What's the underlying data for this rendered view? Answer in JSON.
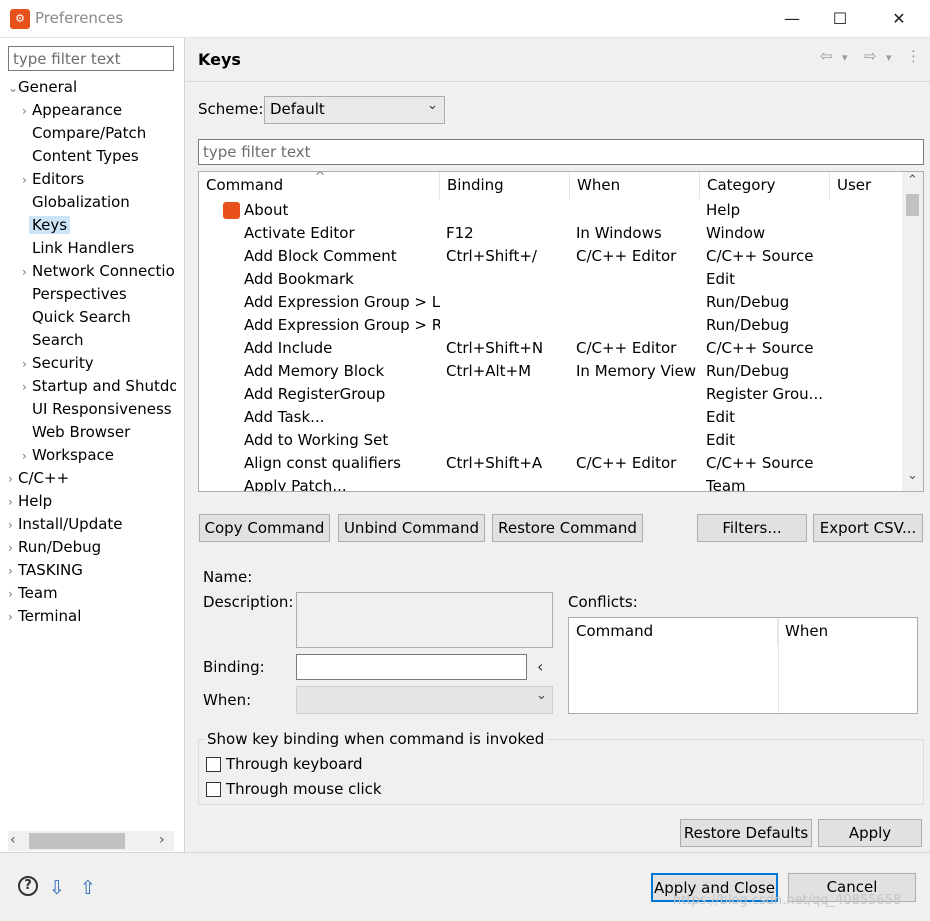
{
  "window": {
    "title": "Preferences",
    "minimize_glyph": "—",
    "maximize_glyph": "☐",
    "close_glyph": "✕",
    "icon": "eclipse-app-icon"
  },
  "left": {
    "filter_placeholder": "type filter text",
    "tree": [
      {
        "label": "General",
        "level": 0,
        "arrow": "⌄"
      },
      {
        "label": "Appearance",
        "level": 1,
        "arrow": "›"
      },
      {
        "label": "Compare/Patch",
        "level": 1,
        "arrow": ""
      },
      {
        "label": "Content Types",
        "level": 1,
        "arrow": ""
      },
      {
        "label": "Editors",
        "level": 1,
        "arrow": "›"
      },
      {
        "label": "Globalization",
        "level": 1,
        "arrow": ""
      },
      {
        "label": "Keys",
        "level": 1,
        "arrow": "",
        "selected": true
      },
      {
        "label": "Link Handlers",
        "level": 1,
        "arrow": ""
      },
      {
        "label": "Network Connectio",
        "level": 1,
        "arrow": "›"
      },
      {
        "label": "Perspectives",
        "level": 1,
        "arrow": ""
      },
      {
        "label": "Quick Search",
        "level": 1,
        "arrow": ""
      },
      {
        "label": "Search",
        "level": 1,
        "arrow": ""
      },
      {
        "label": "Security",
        "level": 1,
        "arrow": "›"
      },
      {
        "label": "Startup and Shutdo",
        "level": 1,
        "arrow": "›"
      },
      {
        "label": "UI Responsiveness",
        "level": 1,
        "arrow": ""
      },
      {
        "label": "Web Browser",
        "level": 1,
        "arrow": ""
      },
      {
        "label": "Workspace",
        "level": 1,
        "arrow": "›"
      },
      {
        "label": "C/C++",
        "level": 0,
        "arrow": "›"
      },
      {
        "label": "Help",
        "level": 0,
        "arrow": "›"
      },
      {
        "label": "Install/Update",
        "level": 0,
        "arrow": "›"
      },
      {
        "label": "Run/Debug",
        "level": 0,
        "arrow": "›"
      },
      {
        "label": "TASKING",
        "level": 0,
        "arrow": "›"
      },
      {
        "label": "Team",
        "level": 0,
        "arrow": "›"
      },
      {
        "label": "Terminal",
        "level": 0,
        "arrow": "›"
      }
    ],
    "scroll_left": "‹",
    "scroll_right": "›"
  },
  "page": {
    "heading": "Keys",
    "back_glyph": "⇦",
    "forward_glyph": "⇨",
    "dropdown_glyph": "▾",
    "menu_glyph": "⋮",
    "scheme_label": "Scheme:",
    "scheme_value": "Default",
    "filter_placeholder": "type filter text"
  },
  "table": {
    "columns": [
      "Command",
      "Binding",
      "When",
      "Category",
      "User"
    ],
    "sort_glyph": "^",
    "rows": [
      {
        "command": "About",
        "binding": "",
        "when": "",
        "category": "Help",
        "icon": true
      },
      {
        "command": "Activate Editor",
        "binding": "F12",
        "when": "In Windows",
        "category": "Window"
      },
      {
        "command": "Add Block Comment",
        "binding": "Ctrl+Shift+/",
        "when": "C/C++ Editor",
        "category": "C/C++ Source"
      },
      {
        "command": "Add Bookmark",
        "binding": "",
        "when": "",
        "category": "Edit"
      },
      {
        "command": "Add Expression Group > Lo",
        "binding": "",
        "when": "",
        "category": "Run/Debug"
      },
      {
        "command": "Add Expression Group > Re",
        "binding": "",
        "when": "",
        "category": "Run/Debug"
      },
      {
        "command": "Add Include",
        "binding": "Ctrl+Shift+N",
        "when": "C/C++ Editor",
        "category": "C/C++ Source"
      },
      {
        "command": "Add Memory Block",
        "binding": "Ctrl+Alt+M",
        "when": "In Memory View",
        "category": "Run/Debug"
      },
      {
        "command": "Add RegisterGroup",
        "binding": "",
        "when": "",
        "category": "Register Grou..."
      },
      {
        "command": "Add Task...",
        "binding": "",
        "when": "",
        "category": "Edit"
      },
      {
        "command": "Add to Working Set",
        "binding": "",
        "when": "",
        "category": "Edit"
      },
      {
        "command": "Align const qualifiers",
        "binding": "Ctrl+Shift+A",
        "when": "C/C++ Editor",
        "category": "C/C++ Source"
      },
      {
        "command": "Apply Patch...",
        "binding": "",
        "when": "",
        "category": "Team"
      }
    ],
    "scroll_up": "⌃",
    "scroll_down": "⌄"
  },
  "buttons": {
    "copy": "Copy Command",
    "unbind": "Unbind Command",
    "restore": "Restore Command",
    "filters": "Filters...",
    "export": "Export CSV...",
    "restore_defaults": "Restore Defaults",
    "apply": "Apply",
    "apply_close": "Apply and Close",
    "cancel": "Cancel"
  },
  "details": {
    "name_label": "Name:",
    "description_label": "Description:",
    "binding_label": "Binding:",
    "binding_arrow": "‹",
    "when_label": "When:",
    "when_chevron": "⌄",
    "conflicts_label": "Conflicts:",
    "conflicts_columns": [
      "Command",
      "When"
    ]
  },
  "show_group": {
    "title": "Show key binding when command is invoked",
    "through_keyboard": "Through keyboard",
    "through_mouse": "Through mouse click"
  },
  "bottom": {
    "help_glyph": "?",
    "import_glyph": "⇩",
    "export_glyph": "⇧"
  },
  "watermark": "https://blog.csdn.net/qq_40855658",
  "colors": {
    "accent": "#0078d7",
    "selection": "#cce4f7",
    "brand": "#e8501c"
  }
}
